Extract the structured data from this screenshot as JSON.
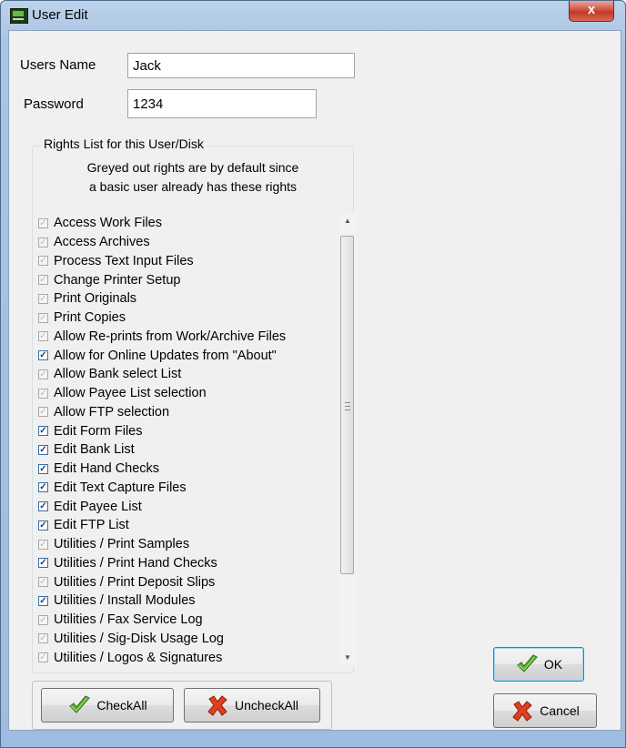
{
  "window": {
    "title": "User Edit",
    "close_glyph": "x"
  },
  "form": {
    "users_name_label": "Users Name",
    "users_name_value": "Jack",
    "password_label": "Password",
    "password_value": "1234"
  },
  "rights": {
    "group_title": "Rights List for  this  User/Disk",
    "note_line1": "Greyed out rights are by default since",
    "note_line2": "a basic user already has these rights",
    "items": [
      {
        "label": "Access Work Files",
        "checked": true,
        "greyed": true
      },
      {
        "label": "Access Archives",
        "checked": true,
        "greyed": true
      },
      {
        "label": "Process Text Input Files",
        "checked": true,
        "greyed": true
      },
      {
        "label": "Change Printer Setup",
        "checked": true,
        "greyed": true
      },
      {
        "label": "Print Originals",
        "checked": true,
        "greyed": true
      },
      {
        "label": "Print Copies",
        "checked": true,
        "greyed": true
      },
      {
        "label": "Allow Re-prints from Work/Archive Files",
        "checked": true,
        "greyed": true
      },
      {
        "label": "Allow for Online Updates from \"About\"",
        "checked": true,
        "greyed": false
      },
      {
        "label": "Allow Bank select List",
        "checked": true,
        "greyed": true
      },
      {
        "label": "Allow Payee List selection",
        "checked": true,
        "greyed": true
      },
      {
        "label": "Allow FTP selection",
        "checked": true,
        "greyed": true
      },
      {
        "label": "Edit Form Files",
        "checked": true,
        "greyed": false
      },
      {
        "label": "Edit Bank List",
        "checked": true,
        "greyed": false
      },
      {
        "label": "Edit Hand Checks",
        "checked": true,
        "greyed": false
      },
      {
        "label": "Edit Text Capture Files",
        "checked": true,
        "greyed": false
      },
      {
        "label": "Edit Payee List",
        "checked": true,
        "greyed": false
      },
      {
        "label": "Edit FTP List",
        "checked": true,
        "greyed": false
      },
      {
        "label": "Utilities / Print Samples",
        "checked": true,
        "greyed": true
      },
      {
        "label": "Utilities / Print Hand Checks",
        "checked": true,
        "greyed": false
      },
      {
        "label": "Utilities / Print Deposit Slips",
        "checked": true,
        "greyed": true
      },
      {
        "label": "Utilities / Install Modules",
        "checked": true,
        "greyed": false
      },
      {
        "label": "Utilities / Fax Service Log",
        "checked": true,
        "greyed": true
      },
      {
        "label": "Utilities / Sig-Disk Usage Log",
        "checked": true,
        "greyed": true
      },
      {
        "label": "Utilities / Logos & Signatures",
        "checked": true,
        "greyed": true
      }
    ]
  },
  "buttons": {
    "check_all": "CheckAll",
    "uncheck_all": "UncheckAll",
    "ok": "OK",
    "cancel": "Cancel"
  }
}
